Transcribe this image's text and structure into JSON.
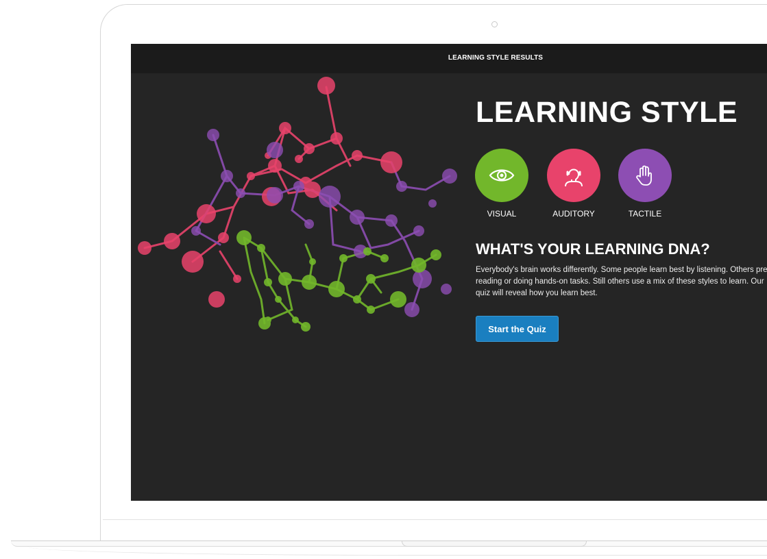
{
  "topbar": {
    "title": "LEARNING STYLE RESULTS"
  },
  "hero": {
    "heading": "LEARNING STYLE"
  },
  "styles": [
    {
      "label": "VISUAL",
      "icon": "eye-icon",
      "color": "#72b72b"
    },
    {
      "label": "AUDITORY",
      "icon": "head-listening-icon",
      "color": "#e8436b"
    },
    {
      "label": "TACTILE",
      "icon": "hand-icon",
      "color": "#8d4eb3"
    }
  ],
  "section": {
    "heading": "WHAT'S YOUR LEARNING DNA?",
    "description": "Everybody's brain works differently. Some people learn best by listening. Others prefer reading or doing hands-on tasks. Still others use a mix of these styles to learn. Our quiz will reveal how you learn best."
  },
  "cta": {
    "label": "Start the Quiz",
    "color": "#1a7fc0"
  },
  "colors": {
    "screen_bg": "#252525",
    "topbar_bg": "#1b1b1b",
    "pink": "#e8436b",
    "purple": "#8d4eb3",
    "green": "#72b72b"
  }
}
